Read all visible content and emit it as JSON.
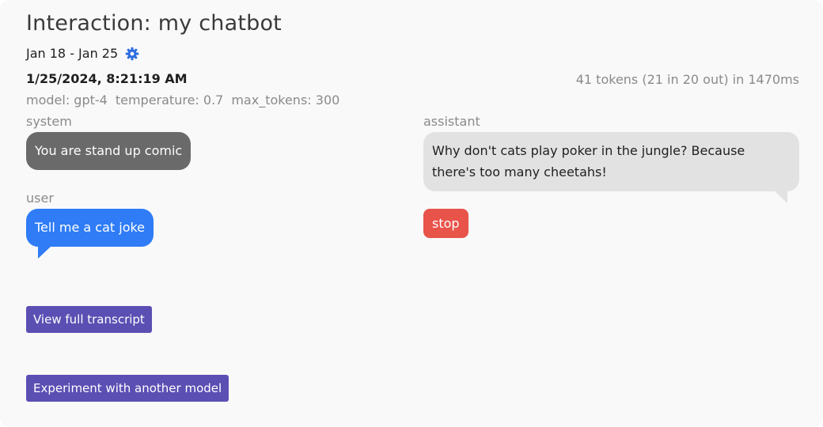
{
  "header": {
    "title": "Interaction: my chatbot",
    "date_range": "Jan 18 - Jan 25",
    "settings_icon": "gear-icon",
    "accent_color": "#2f6fe0"
  },
  "run": {
    "timestamp": "1/25/2024, 8:21:19 AM",
    "tokens_summary": "41 tokens (21 in 20 out) in 1470ms",
    "params": {
      "model": "model: gpt-4",
      "temperature": "temperature: 0.7",
      "max_tokens": "max_tokens: 300"
    }
  },
  "messages": {
    "system": {
      "role": "system",
      "text": "You are stand up comic"
    },
    "user": {
      "role": "user",
      "text": "Tell me a cat joke"
    },
    "assistant": {
      "role": "assistant",
      "text": "Why don't cats play poker in the jungle? Because there's too many cheetahs!"
    }
  },
  "finish_reason": "stop",
  "actions": {
    "view_transcript": "View full transcript",
    "experiment": "Experiment with another model"
  },
  "colors": {
    "system_bubble": "#6a6a6a",
    "user_bubble": "#2f7cf6",
    "assistant_bubble": "#e2e2e2",
    "stop_badge": "#e8534a",
    "button": "#5b4fb3"
  }
}
